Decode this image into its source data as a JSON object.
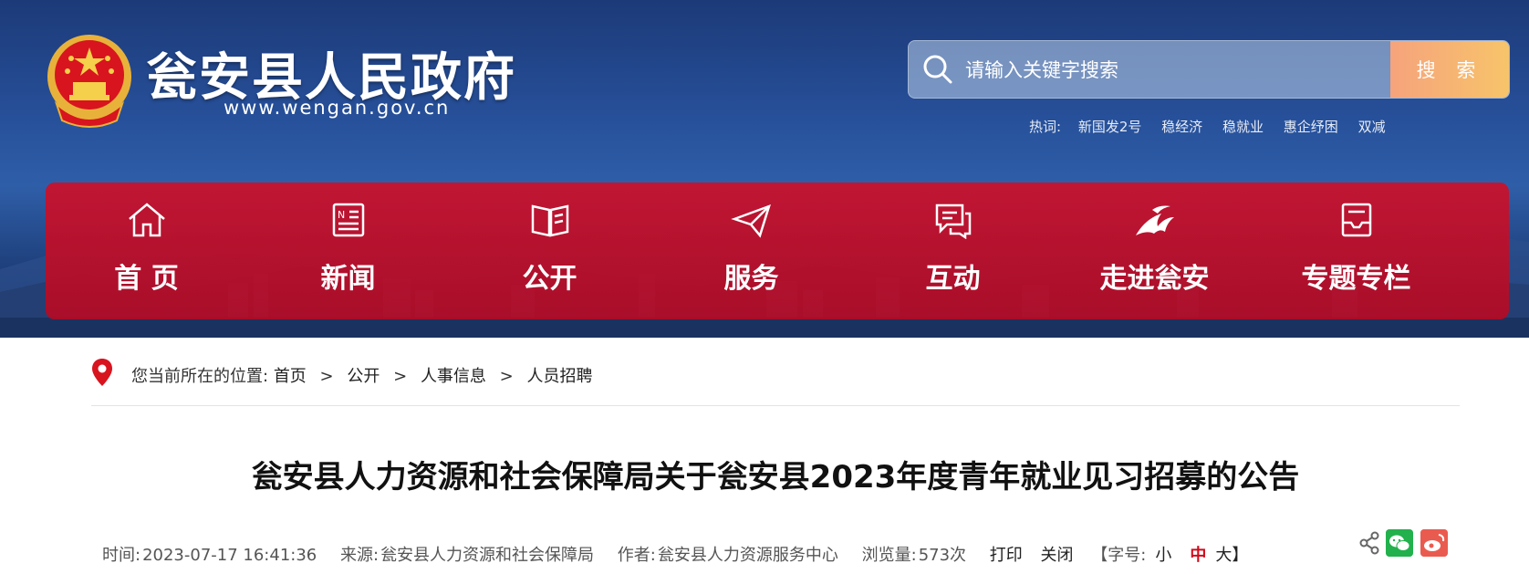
{
  "header": {
    "site_name": "瓮安县人民政府",
    "site_url": "www.wengan.gov.cn",
    "emblem": "national-emblem-icon"
  },
  "search": {
    "placeholder": "请输入关键字搜索",
    "button_label": "搜 索"
  },
  "hotwords": {
    "label": "热词:",
    "items": [
      "新国发2号",
      "稳经济",
      "稳就业",
      "惠企纾困",
      "双减"
    ]
  },
  "nav": {
    "items": [
      {
        "label": "首 页",
        "icon": "home-icon"
      },
      {
        "label": "新闻",
        "icon": "news-icon"
      },
      {
        "label": "公开",
        "icon": "book-icon"
      },
      {
        "label": "服务",
        "icon": "paper-plane-icon"
      },
      {
        "label": "互动",
        "icon": "chat-icon"
      },
      {
        "label": "走进瓮安",
        "icon": "landmark-icon"
      },
      {
        "label": "专题专栏",
        "icon": "inbox-icon"
      }
    ]
  },
  "breadcrumb": {
    "prefix": "您当前所在的位置:",
    "items": [
      "首页",
      "公开",
      "人事信息",
      "人员招聘"
    ],
    "separator": ">"
  },
  "article": {
    "title": "瓮安县人力资源和社会保障局关于瓮安县2023年度青年就业见习招募的公告",
    "time_label": "时间:",
    "time": "2023-07-17 16:41:36",
    "source_label": "来源:",
    "source": "瓮安县人力资源和社会保障局",
    "author_label": "作者:",
    "author": "瓮安县人力资源服务中心",
    "views_label": "浏览量:",
    "views": "573次",
    "print_label": "打印",
    "close_label": "关闭",
    "font_size_label": "【字号:",
    "font_small": "小",
    "font_medium": "中",
    "font_large": "大】"
  },
  "colors": {
    "nav_red": "#c8122d",
    "search_button": "#f7b56f",
    "active_font": "#d10a1a"
  }
}
